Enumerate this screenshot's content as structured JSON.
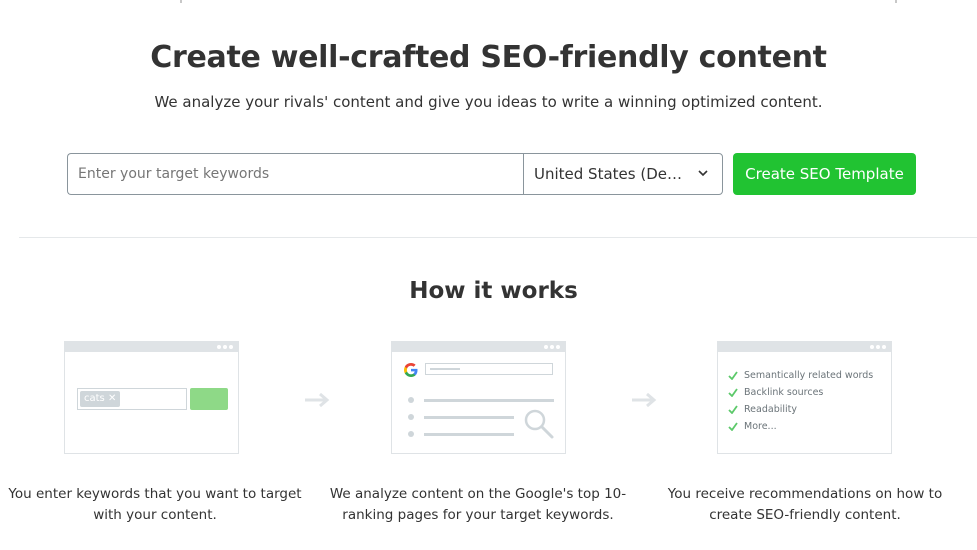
{
  "hero": {
    "title": "Create well-crafted SEO-friendly content",
    "subtitle": "We analyze your rivals' content and give you ideas to write a winning optimized content."
  },
  "search": {
    "keyword_placeholder": "Enter your target keywords",
    "keyword_value": "",
    "database_selected": "United States (Desktop)",
    "submit_label": "Create SEO Template"
  },
  "how": {
    "title": "How it works",
    "steps": [
      {
        "text": "You enter keywords that you want to target with your content.",
        "illustration": {
          "chip_label": "cats",
          "chip_remove": "✕"
        }
      },
      {
        "text": "We analyze content on the Google's top 10-ranking pages for your target keywords.",
        "illustration": {
          "logo_letter": "G"
        }
      },
      {
        "text": "You receive recommendations on how to create SEO-friendly content.",
        "illustration": {
          "items": [
            "Semantically related words",
            "Backlink sources",
            "Readability",
            "More..."
          ]
        }
      }
    ]
  },
  "colors": {
    "accent_green": "#21c332",
    "light_green": "#8ed987",
    "check_green": "#5cc96a",
    "illustration_gray": "#cfd6da",
    "text": "#333333"
  }
}
